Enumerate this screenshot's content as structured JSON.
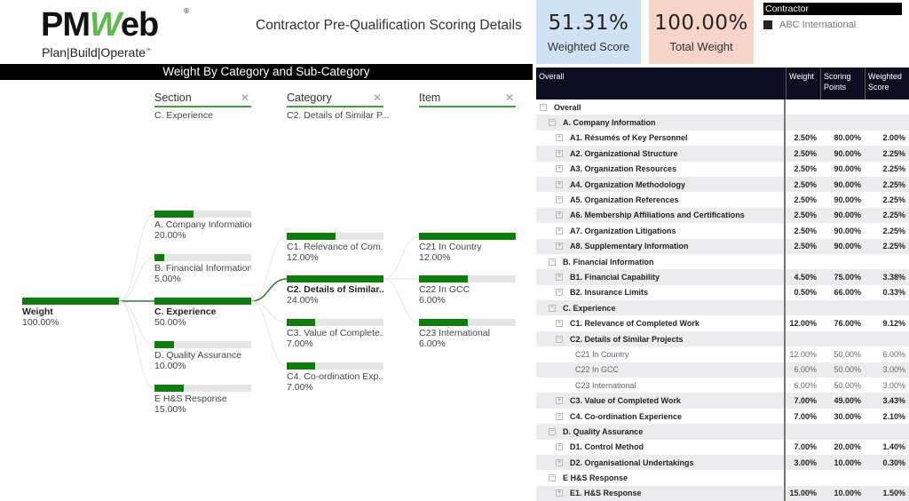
{
  "logo": {
    "brand_prefix": "PM",
    "brand_w": "W",
    "brand_suffix": "eb",
    "registered": "®",
    "tagline": "Plan|Build|Operate",
    "tm": "™"
  },
  "report_title": "Contractor Pre-Qualification Scoring Details",
  "cards": {
    "weighted_score": {
      "value": "51.31%",
      "label": "Weighted Score",
      "color": "#cfe2f3"
    },
    "total_weight": {
      "value": "100.00%",
      "label": "Total Weight",
      "color": "#f6d4c9"
    }
  },
  "slicer": {
    "title": "Contractor",
    "items": [
      {
        "label": "ABC International",
        "selected": true
      }
    ]
  },
  "tree": {
    "title": "Weight By Category and Sub-Category",
    "bar_color": "#107c10",
    "columns": [
      {
        "header": "Section",
        "selected": "C. Experience"
      },
      {
        "header": "Category",
        "selected": "C2. Details of Similar P..."
      },
      {
        "header": "Item",
        "selected": ""
      }
    ],
    "root": {
      "label": "Weight",
      "value": "100.00%",
      "pct": 100
    },
    "level1": [
      {
        "label": "A. Company Information",
        "value": "20.00%",
        "pct": 20
      },
      {
        "label": "B. Financial Information",
        "value": "5.00%",
        "pct": 5
      },
      {
        "label": "C. Experience",
        "value": "50.00%",
        "pct": 50,
        "selected": true
      },
      {
        "label": "D. Quality Assurance",
        "value": "10.00%",
        "pct": 10
      },
      {
        "label": "E H&S Response",
        "value": "15.00%",
        "pct": 15
      }
    ],
    "level2": [
      {
        "label": "C1. Relevance of Com...",
        "value": "12.00%",
        "pct": 12
      },
      {
        "label": "C2. Details of Similar...",
        "value": "24.00%",
        "pct": 24,
        "selected": true
      },
      {
        "label": "C3. Value of Complete...",
        "value": "7.00%",
        "pct": 7
      },
      {
        "label": "C4. Co-ordination Exp...",
        "value": "7.00%",
        "pct": 7
      }
    ],
    "level3": [
      {
        "label": "C21 In Country",
        "value": "12.00%",
        "pct": 12
      },
      {
        "label": "C22 In GCC",
        "value": "6.00%",
        "pct": 6
      },
      {
        "label": "C23 International",
        "value": "6.00%",
        "pct": 6
      }
    ]
  },
  "table": {
    "headers": [
      "Overall",
      "Weight",
      "Scoring Points",
      "Weighted Score"
    ],
    "rows": [
      {
        "level": 0,
        "toggle": "−",
        "label": "Overall",
        "weight": "",
        "points": "",
        "score": ""
      },
      {
        "level": 1,
        "toggle": "−",
        "label": "A. Company Information",
        "weight": "",
        "points": "",
        "score": ""
      },
      {
        "level": 2,
        "toggle": "+",
        "label": "A1. Résumés of Key Personnel",
        "weight": "2.50%",
        "points": "80.00%",
        "score": "2.00%"
      },
      {
        "level": 2,
        "toggle": "+",
        "label": "A2. Organizational Structure",
        "weight": "2.50%",
        "points": "90.00%",
        "score": "2.25%"
      },
      {
        "level": 2,
        "toggle": "+",
        "label": "A3. Organization Resources",
        "weight": "2.50%",
        "points": "90.00%",
        "score": "2.25%"
      },
      {
        "level": 2,
        "toggle": "+",
        "label": "A4. Organization Methodology",
        "weight": "2.50%",
        "points": "90.00%",
        "score": "2.25%"
      },
      {
        "level": 2,
        "toggle": "+",
        "label": "A5. Organization References",
        "weight": "2.50%",
        "points": "90.00%",
        "score": "2.25%"
      },
      {
        "level": 2,
        "toggle": "+",
        "label": "A6. Membership Affiliations and Certifications",
        "weight": "2.50%",
        "points": "90.00%",
        "score": "2.25%"
      },
      {
        "level": 2,
        "toggle": "+",
        "label": "A7. Organization Litigations",
        "weight": "2.50%",
        "points": "90.00%",
        "score": "2.25%"
      },
      {
        "level": 2,
        "toggle": "+",
        "label": "A8. Supplementary Information",
        "weight": "2.50%",
        "points": "90.00%",
        "score": "2.25%"
      },
      {
        "level": 1,
        "toggle": "−",
        "label": "B. Financial Information",
        "weight": "",
        "points": "",
        "score": ""
      },
      {
        "level": 2,
        "toggle": "+",
        "label": "B1. Financial Capability",
        "weight": "4.50%",
        "points": "75.00%",
        "score": "3.38%"
      },
      {
        "level": 2,
        "toggle": "+",
        "label": "B2. Insurance Limits",
        "weight": "0.50%",
        "points": "66.00%",
        "score": "0.33%"
      },
      {
        "level": 1,
        "toggle": "−",
        "label": "C. Experience",
        "weight": "",
        "points": "",
        "score": ""
      },
      {
        "level": 2,
        "toggle": "+",
        "label": "C1. Relevance of Completed Work",
        "weight": "12.00%",
        "points": "76.00%",
        "score": "9.12%"
      },
      {
        "level": 2,
        "toggle": "−",
        "label": "C2. Details of Similar Projects",
        "weight": "",
        "points": "",
        "score": ""
      },
      {
        "level": 3,
        "toggle": "",
        "label": "C21 In Country",
        "weight": "12.00%",
        "points": "50.00%",
        "score": "6.00%"
      },
      {
        "level": 3,
        "toggle": "",
        "label": "C22 In GCC",
        "weight": "6.00%",
        "points": "50.00%",
        "score": "3.00%"
      },
      {
        "level": 3,
        "toggle": "",
        "label": "C23 International",
        "weight": "6.00%",
        "points": "50.00%",
        "score": "3.00%"
      },
      {
        "level": 2,
        "toggle": "+",
        "label": "C3. Value of Completed Work",
        "weight": "7.00%",
        "points": "49.00%",
        "score": "3.43%"
      },
      {
        "level": 2,
        "toggle": "+",
        "label": "C4. Co-ordination Experience",
        "weight": "7.00%",
        "points": "30.00%",
        "score": "2.10%"
      },
      {
        "level": 1,
        "toggle": "−",
        "label": "D. Quality Assurance",
        "weight": "",
        "points": "",
        "score": ""
      },
      {
        "level": 2,
        "toggle": "+",
        "label": "D1. Control Method",
        "weight": "7.00%",
        "points": "20.00%",
        "score": "1.40%"
      },
      {
        "level": 2,
        "toggle": "+",
        "label": "D2. Organisational Undertakings",
        "weight": "3.00%",
        "points": "10.00%",
        "score": "0.30%"
      },
      {
        "level": 1,
        "toggle": "−",
        "label": "E H&S Response",
        "weight": "",
        "points": "",
        "score": ""
      },
      {
        "level": 2,
        "toggle": "+",
        "label": "E1. H&S Response",
        "weight": "15.00%",
        "points": "10.00%",
        "score": "1.50%"
      }
    ]
  }
}
